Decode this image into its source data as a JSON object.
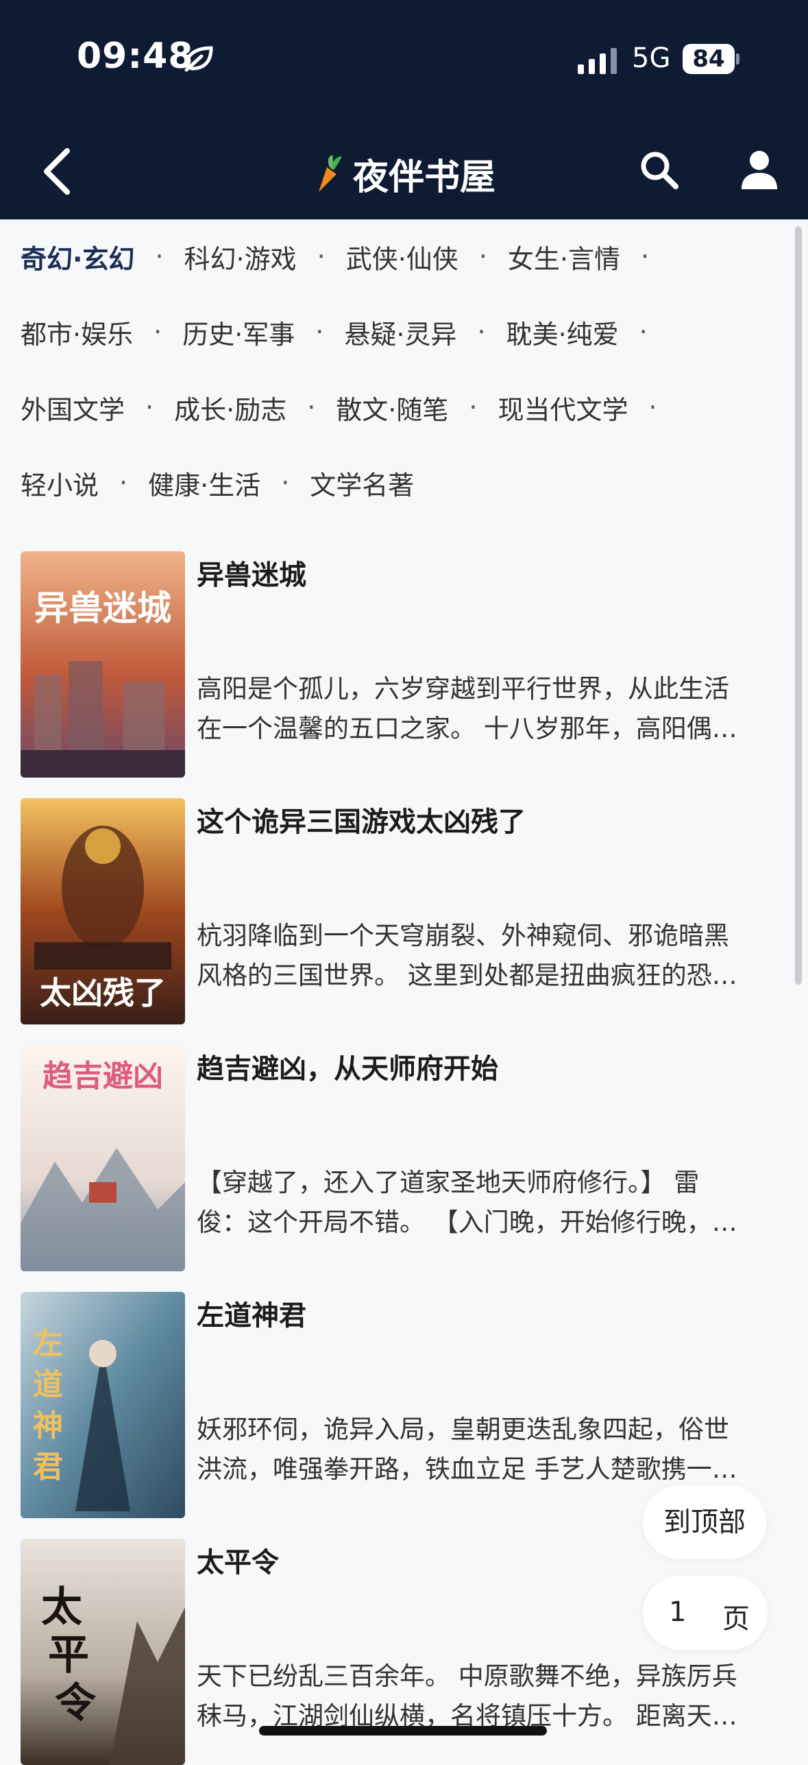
{
  "status": {
    "time": "09:48",
    "network": "5G",
    "battery": "84"
  },
  "header": {
    "title": "夜伴书屋",
    "icons": [
      "back-icon",
      "carrot-logo-icon",
      "search-icon",
      "user-icon"
    ]
  },
  "categories": [
    "奇幻·玄幻",
    "科幻·游戏",
    "武侠·仙侠",
    "女生·言情",
    "都市·娱乐",
    "历史·军事",
    "悬疑·灵异",
    "耽美·纯爱",
    "外国文学",
    "成长·励志",
    "散文·随笔",
    "现当代文学",
    "轻小说",
    "健康·生活",
    "文学名著"
  ],
  "separator": "·",
  "active_category": "奇幻·玄幻",
  "books": [
    {
      "title": "异兽迷城",
      "desc_line1": "高阳是个孤儿，六岁穿越到平行世界，从此生活",
      "desc_line2": "在一个温馨的五口之家。 十八岁那年，高阳偶…",
      "cover_text": "异兽迷城",
      "cover_colors": [
        "#f0b48a",
        "#c05a3a",
        "#6a4a6a"
      ]
    },
    {
      "title": "这个诡异三国游戏太凶残了",
      "desc_line1": "杭羽降临到一个天穹崩裂、外神窥伺、邪诡暗黑",
      "desc_line2": "风格的三国世界。 这里到处都是扭曲疯狂的恐…",
      "cover_text": "太凶残了",
      "cover_colors": [
        "#f3c260",
        "#a0481f",
        "#3a1e18"
      ]
    },
    {
      "title": "趋吉避凶，从天师府开始",
      "desc_line1": "【穿越了，还入了道家圣地天师府修行。】 雷",
      "desc_line2": "俊：这个开局不错。 【入门晚，开始修行晚，…",
      "cover_text": "趋吉避凶",
      "cover_colors": [
        "#fdf5f0",
        "#e7d9d3",
        "#8b9aa8"
      ]
    },
    {
      "title": "左道神君",
      "desc_line1": "妖邪环伺，诡异入局，皇朝更迭乱象四起，俗世",
      "desc_line2": "洪流，唯强拳开路，铁血立足 手艺人楚歌携一…",
      "cover_text": "左道神君",
      "cover_colors": [
        "#5f8aa0",
        "#2f4a60",
        "#c7d7df"
      ]
    },
    {
      "title": "太平令",
      "desc_line1": "天下已纷乱三百余年。 中原歌舞不绝，异族厉兵",
      "desc_line2": "秣马，江湖剑仙纵横，名将镇压十方。 距离天…",
      "cover_text": "太平令",
      "cover_colors": [
        "#e9e4dc",
        "#b8ada0",
        "#3c3026"
      ]
    }
  ],
  "controls": {
    "to_top": "到顶部",
    "page_number": "1",
    "page_unit": "页"
  }
}
